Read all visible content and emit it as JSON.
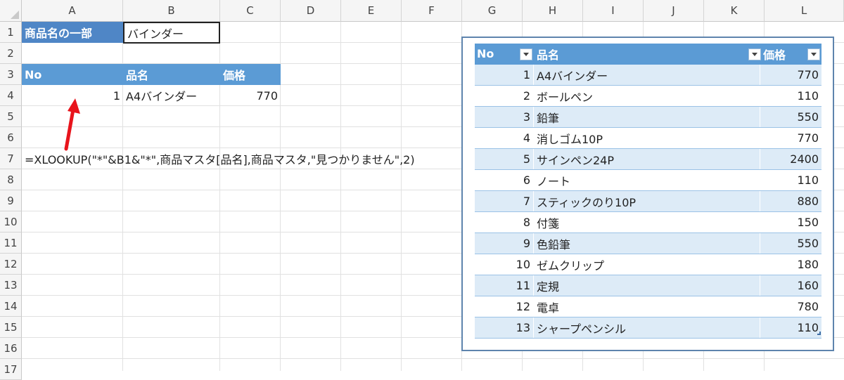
{
  "columns": [
    "A",
    "B",
    "C",
    "D",
    "E",
    "F",
    "G",
    "H",
    "I",
    "J",
    "K",
    "L"
  ],
  "rows": [
    "1",
    "2",
    "3",
    "4",
    "5",
    "6",
    "7",
    "8",
    "9",
    "10",
    "11",
    "12",
    "13",
    "14",
    "15",
    "16",
    "17"
  ],
  "cells": {
    "a1": "商品名の一部",
    "b1": "バインダー",
    "a3": "No",
    "b3": "品名",
    "c3": "価格",
    "a4": "1",
    "b4": "A4バインダー",
    "c4": "770",
    "a7": "=XLOOKUP(\"*\"&B1&\"*\",商品マスタ[品名],商品マスタ,\"見つかりません\",2)"
  },
  "table": {
    "headers": [
      "No",
      "品名",
      "価格"
    ],
    "rows": [
      [
        "1",
        "A4バインダー",
        "770"
      ],
      [
        "2",
        "ボールペン",
        "110"
      ],
      [
        "3",
        "鉛筆",
        "550"
      ],
      [
        "4",
        "消しゴム10P",
        "770"
      ],
      [
        "5",
        "サインペン24P",
        "2400"
      ],
      [
        "6",
        "ノート",
        "110"
      ],
      [
        "7",
        "スティックのり10P",
        "880"
      ],
      [
        "8",
        "付箋",
        "150"
      ],
      [
        "9",
        "色鉛筆",
        "550"
      ],
      [
        "10",
        "ゼムクリップ",
        "180"
      ],
      [
        "11",
        "定規",
        "160"
      ],
      [
        "12",
        "電卓",
        "780"
      ],
      [
        "13",
        "シャープペンシル",
        "110"
      ]
    ]
  },
  "colors": {
    "header_dark": "#4f86c6",
    "header_table": "#5b9bd5",
    "band": "#ddebf7",
    "arrow": "#e8141c"
  }
}
